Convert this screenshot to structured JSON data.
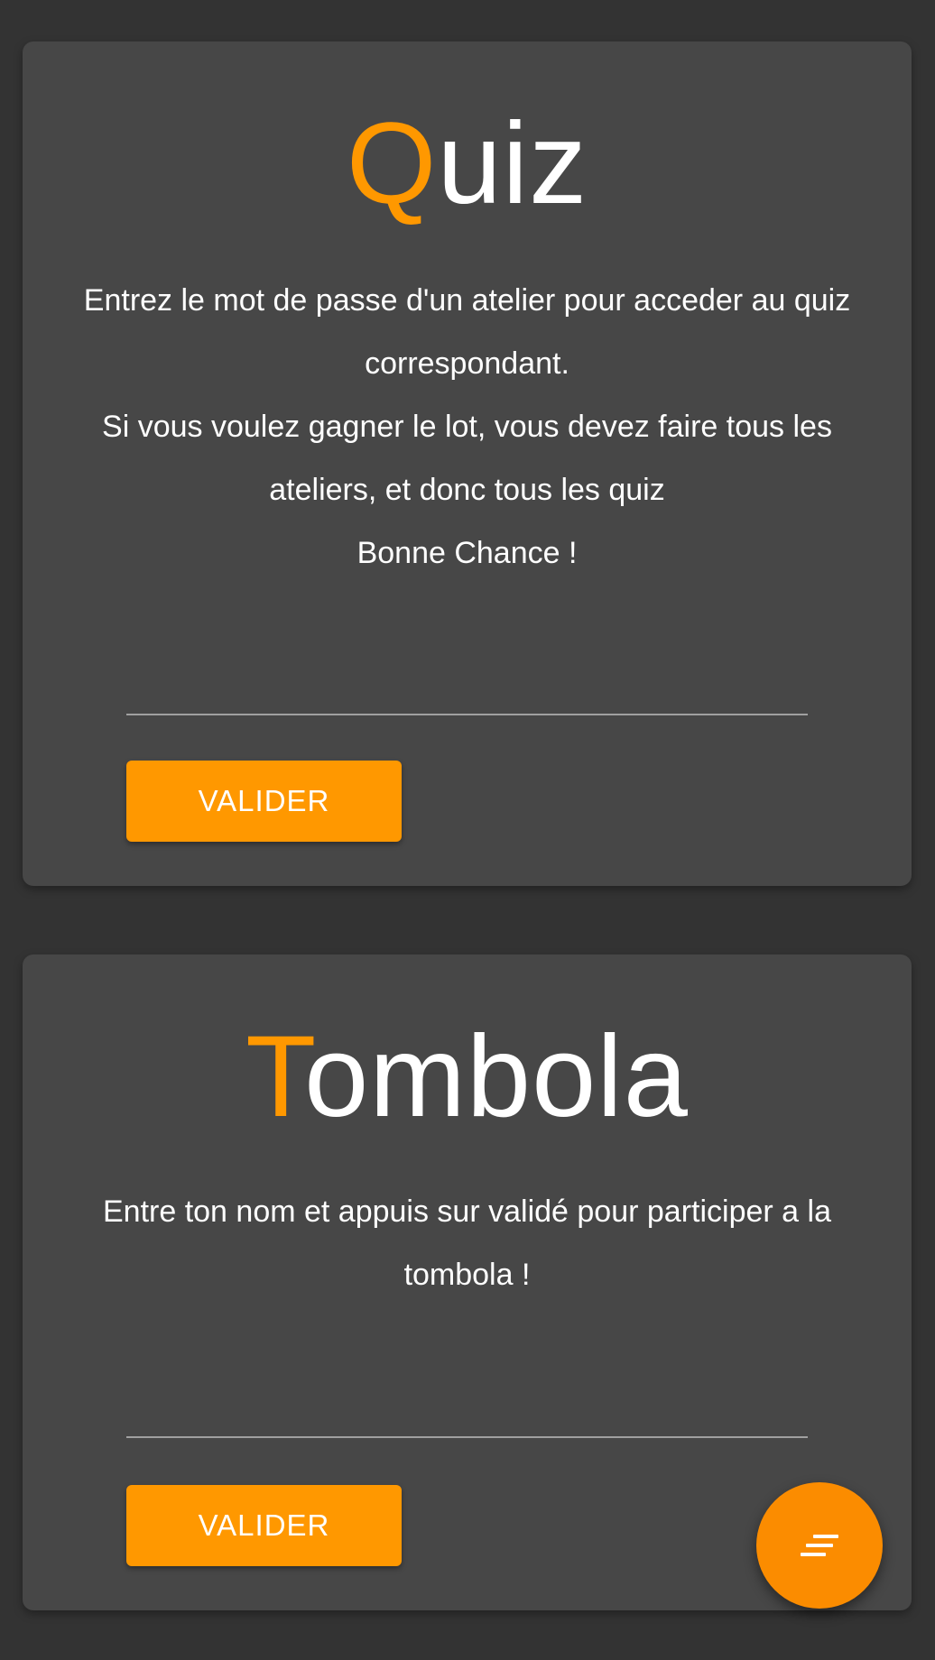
{
  "colors": {
    "background": "#333333",
    "card": "#474747",
    "accent": "#ff9800",
    "text": "#ffffff"
  },
  "quiz": {
    "title_first_letter": "Q",
    "title_rest": "uiz",
    "paragraphs": [
      "Entrez le mot de passe d'un atelier pour acceder au quiz correspondant.",
      "Si vous voulez gagner le lot, vous devez faire tous les ateliers, et donc tous les quiz",
      "Bonne Chance !"
    ],
    "input_value": "",
    "submit_label": "VALIDER"
  },
  "tombola": {
    "title_first_letter": "T",
    "title_rest": "ombola",
    "paragraphs": [
      "Entre ton nom et appuis sur validé pour participer a la tombola !"
    ],
    "input_value": "",
    "submit_label": "VALIDER"
  },
  "fab": {
    "icon": "sort-lines-icon"
  }
}
